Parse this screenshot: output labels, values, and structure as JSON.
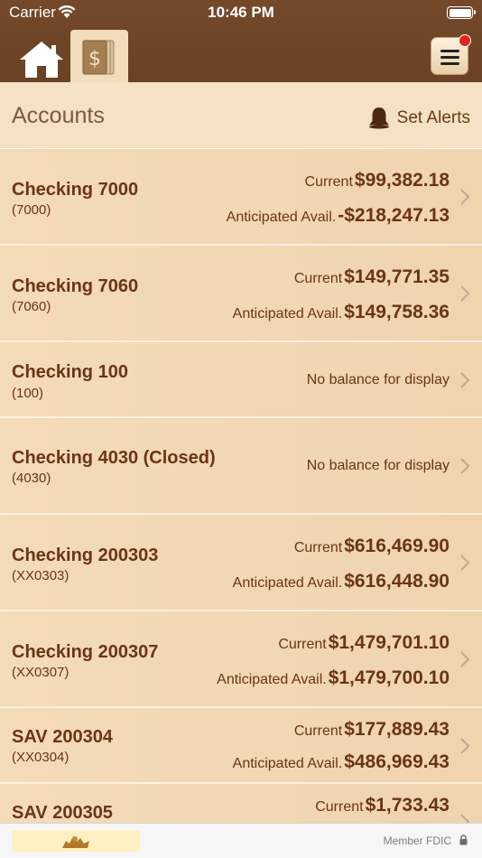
{
  "status_bar": {
    "carrier": "Carrier",
    "time": "10:46 PM"
  },
  "nav": {
    "home_icon": "home-icon",
    "accounts_icon": "dollar-bills-icon",
    "menu_icon": "hamburger-menu-icon",
    "menu_has_notification": true
  },
  "header": {
    "title": "Accounts",
    "alerts_label": "Set Alerts",
    "alerts_icon": "bell-icon"
  },
  "accounts": [
    {
      "name": "Checking 7000",
      "number": "(7000)",
      "current_label": "Current",
      "current": "$99,382.18",
      "avail_label": "Anticipated Avail.",
      "avail": "-$218,247.13"
    },
    {
      "name": "Checking 7060",
      "number": "(7060)",
      "current_label": "Current",
      "current": "$149,771.35",
      "avail_label": "Anticipated Avail.",
      "avail": "$149,758.36"
    },
    {
      "name": "Checking 100",
      "number": "(100)",
      "no_balance": "No balance for display"
    },
    {
      "name": "Checking 4030 (Closed)",
      "number": "(4030)",
      "no_balance": "No balance for display"
    },
    {
      "name": "Checking 200303",
      "number": "(XX0303)",
      "current_label": "Current",
      "current": "$616,469.90",
      "avail_label": "Anticipated Avail.",
      "avail": "$616,448.90"
    },
    {
      "name": "Checking 200307",
      "number": "(XX0307)",
      "current_label": "Current",
      "current": "$1,479,701.10",
      "avail_label": "Anticipated Avail.",
      "avail": "$1,479,700.10"
    },
    {
      "name": "SAV 200304",
      "number": "(XX0304)",
      "current_label": "Current",
      "current": "$177,889.43",
      "avail_label": "Anticipated Avail.",
      "avail": "$486,969.43"
    },
    {
      "name": "SAV 200305",
      "current_label": "Current",
      "current": "$1,733.43"
    }
  ],
  "footer": {
    "member_text": "Member FDIC",
    "logo_icon": "bank-logo-icon",
    "lock_icon": "lock-icon"
  },
  "colors": {
    "header_bg": "#6e4527",
    "list_bg": "#f3dcb9",
    "text_brown": "#6b3514",
    "notification_red": "#e3231c"
  }
}
